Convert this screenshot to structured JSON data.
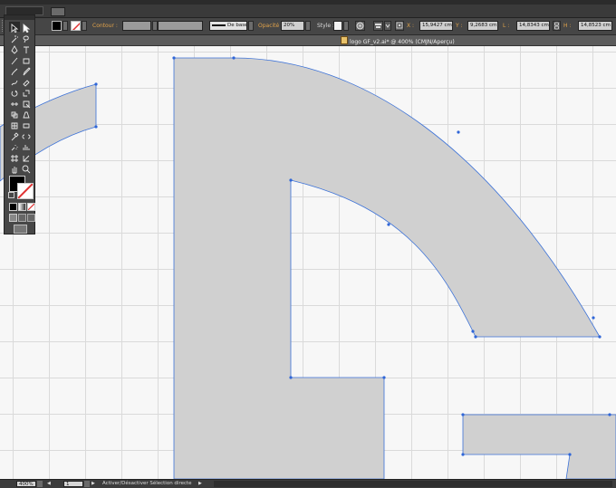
{
  "document": {
    "tab_title": "logo GF_v2.ai* @ 400% (CMJN/Aperçu)"
  },
  "control_panel": {
    "stroke_label": "Contour :",
    "brush_profile": "De base",
    "opacity_label": "Opacité :",
    "opacity_value": "20%",
    "style_label": "Style :",
    "x_label": "X :",
    "x_value": "15,9427 cm",
    "y_label": "Y :",
    "y_value": "9,2683 cm",
    "w_label": "L :",
    "w_value": "14,8343 cm",
    "h_label": "H :",
    "h_value": "14,8523 cm"
  },
  "status_bar": {
    "zoom_value": "400%",
    "page_value": "1",
    "status_text": "Activer/Désactiver Sélection directe"
  },
  "colors": {
    "fill_color": "#000000",
    "shape_fill": "#d0d0d0",
    "path_stroke": "#3c72d8",
    "anchor_color": "#2f66d8",
    "label_accent": "#e0a24a"
  },
  "tools": [
    "selection-icon",
    "direct-selection-icon",
    "magic-wand-icon",
    "lasso-icon",
    "pen-icon",
    "type-icon",
    "line-icon",
    "rectangle-icon",
    "brush-icon",
    "pencil-icon",
    "blob-brush-icon",
    "eraser-icon",
    "rotate-icon",
    "scale-icon",
    "width-icon",
    "free-transform-icon",
    "shape-builder-icon",
    "perspective-icon",
    "mesh-icon",
    "gradient-icon",
    "eyedropper-icon",
    "blend-icon",
    "symbol-sprayer-icon",
    "column-graph-icon",
    "artboard-icon",
    "slice-icon",
    "hand-icon",
    "zoom-icon"
  ]
}
